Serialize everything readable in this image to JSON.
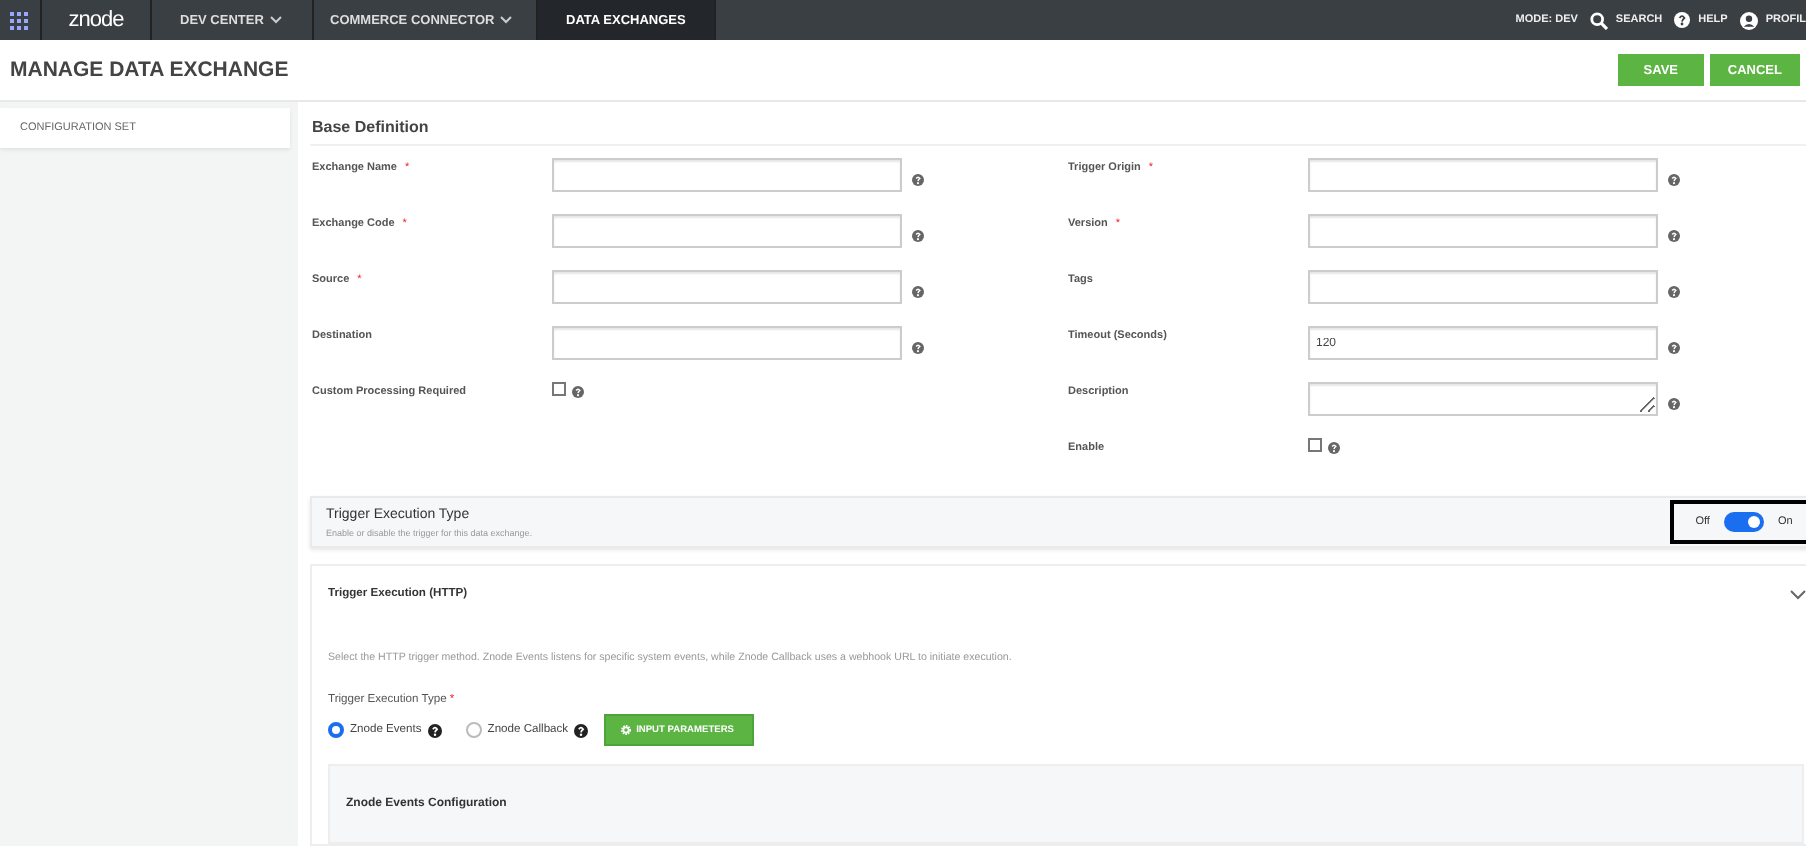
{
  "nav": {
    "logo": "znode",
    "items": [
      {
        "label": "DEV CENTER",
        "dropdown": true,
        "selected": false
      },
      {
        "label": "COMMERCE CONNECTOR",
        "dropdown": true,
        "selected": false
      },
      {
        "label": "DATA EXCHANGES",
        "dropdown": false,
        "selected": true
      }
    ],
    "mode": "MODE: DEV",
    "search": "SEARCH",
    "help": "HELP",
    "profile": "PROFIL"
  },
  "page_title": "MANAGE DATA EXCHANGE",
  "buttons": [
    "SAVE",
    "CANCEL"
  ],
  "sidebar": {
    "items": [
      {
        "label": "CONFIGURATION SET",
        "selected": true
      }
    ]
  },
  "base_definition": {
    "title": "Base Definition",
    "left": [
      {
        "label": "Exchange Name",
        "required_mark": "*",
        "kind": "text"
      },
      {
        "label": "Exchange Code",
        "required_mark": "*",
        "kind": "text"
      },
      {
        "label": "Source",
        "required_mark": "*",
        "kind": "text"
      },
      {
        "label": "Destination",
        "kind": "text"
      },
      {
        "label": "Custom Processing Required",
        "kind": "checkbox",
        "checked": false
      }
    ],
    "right": [
      {
        "label": "Trigger Origin",
        "required_mark": "*",
        "kind": "text"
      },
      {
        "label": "Version",
        "required_mark": "*",
        "kind": "text"
      },
      {
        "label": "Tags",
        "kind": "text"
      },
      {
        "label": "Timeout (Seconds)",
        "kind": "text",
        "value": "120"
      },
      {
        "label": "Description",
        "kind": "textarea"
      },
      {
        "label": "Enable",
        "kind": "checkbox",
        "checked": false
      }
    ]
  },
  "trigger_toggle": {
    "title": "Trigger Execution Type",
    "description": "Enable or disable the trigger for this data exchange.",
    "off_label": "Off",
    "on_label": "On",
    "on": true
  },
  "http_panel": {
    "title": "Trigger Execution (HTTP)",
    "expanded": true,
    "description": "Select the HTTP trigger method. Znode Events listens for specific system events, while Znode Callback uses a webhook URL to initiate execution.",
    "field_label": "Trigger Execution Type",
    "required_mark": "*",
    "options": [
      {
        "label": "Znode Events",
        "selected": true
      },
      {
        "label": "Znode Callback",
        "selected": false
      }
    ],
    "button": "INPUT PARAMETERS",
    "sub_title": "Znode Events Configuration"
  }
}
